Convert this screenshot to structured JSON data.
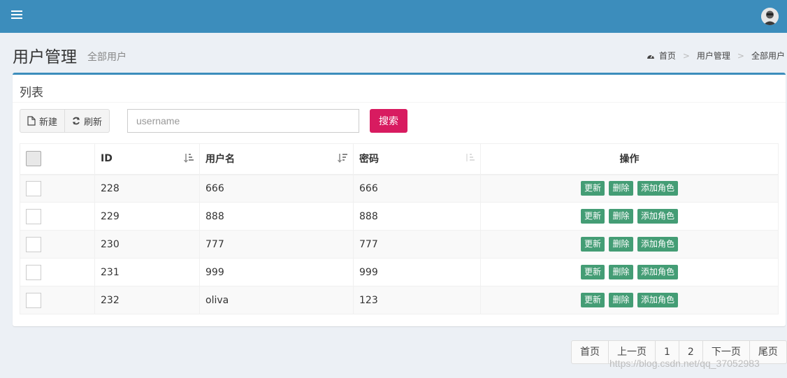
{
  "header": {
    "menu_icon": "hamburger-icon",
    "avatar_icon": "user-avatar-icon",
    "brand_color": "#3c8dbc"
  },
  "page": {
    "title": "用户管理",
    "subtitle": "全部用户",
    "breadcrumb": [
      "首页",
      "用户管理",
      "全部用户"
    ],
    "breadcrumb_icon": "dashboard-icon"
  },
  "box": {
    "title": "列表",
    "new_label": "新建",
    "refresh_label": "刷新",
    "search_placeholder": "username",
    "search_label": "搜索",
    "search_color": "#d81b60"
  },
  "table": {
    "columns": [
      "ID",
      "用户名",
      "密码",
      "操作"
    ],
    "rows": [
      {
        "id": "228",
        "username": "666",
        "password": "666"
      },
      {
        "id": "229",
        "username": "888",
        "password": "888"
      },
      {
        "id": "230",
        "username": "777",
        "password": "777"
      },
      {
        "id": "231",
        "username": "999",
        "password": "999"
      },
      {
        "id": "232",
        "username": "oliva",
        "password": "123"
      }
    ],
    "actions": [
      "更新",
      "删除",
      "添加角色"
    ],
    "action_color": "#449d75"
  },
  "pagination": {
    "first": "首页",
    "prev": "上一页",
    "page1": "1",
    "page2": "2",
    "next": "下一页",
    "last": "尾页"
  },
  "watermark": "https://blog.csdn.net/qq_37052983"
}
